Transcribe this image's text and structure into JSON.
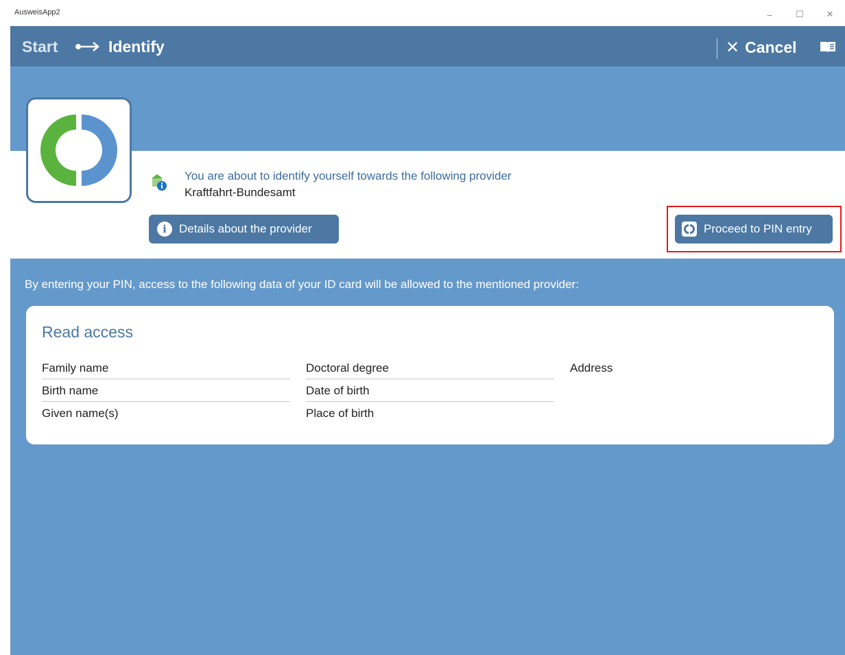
{
  "window": {
    "title": "AusweisApp2",
    "controls": {
      "minimize": "–",
      "maximize": "☐",
      "close": "✕"
    }
  },
  "nav": {
    "breadcrumb_start": "Start",
    "breadcrumb_current": "Identify",
    "cancel_icon": "✕",
    "cancel_label": "Cancel",
    "help_icon": "book-icon"
  },
  "provider": {
    "intro": "You are about to identify yourself towards the following provider",
    "name": "Kraftfahrt-Bundesamt",
    "details_button": "Details about the provider",
    "proceed_button": "Proceed to PIN entry"
  },
  "access_intro": "By entering your PIN, access to the following data of your ID card will be allowed to the mentioned provider:",
  "read_access": {
    "title": "Read access",
    "columns": [
      [
        "Family name",
        "Birth name",
        "Given name(s)"
      ],
      [
        "Doctoral degree",
        "Date of birth",
        "Place of birth"
      ],
      [
        "Address"
      ]
    ]
  },
  "colors": {
    "background": "#6499cb",
    "nav": "#4c78a3",
    "highlight": "#e01a1a",
    "logo_green": "#5ab33e",
    "logo_blue": "#5b93cf"
  }
}
